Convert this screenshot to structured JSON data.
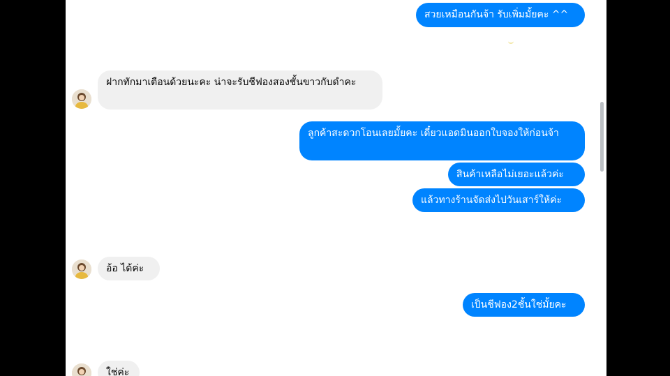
{
  "messages": [
    {
      "id": "m1",
      "side": "outgoing",
      "text": "สวยเหมือนกันจ้า รับเพิ่มมั้ยคะ ^^"
    },
    {
      "id": "m2",
      "side": "incoming",
      "text": "ฝากทักมาเตือนด้วยนะคะ  น่าจะรับชีฟองสองชั้นขาวกับดำคะ"
    },
    {
      "id": "m3",
      "side": "outgoing",
      "text": "ลูกค้าสะดวกโอนเลยมั้ยคะ เดี๋ยวแอดมินออกใบจองให้ก่อนจ้า"
    },
    {
      "id": "m4",
      "side": "outgoing",
      "text": "สินค้าเหลือไม่เยอะแล้วค่ะ"
    },
    {
      "id": "m5",
      "side": "outgoing",
      "text": "แล้วทางร้านจัดส่งไปวันเสาร์ให้ค่ะ"
    },
    {
      "id": "m6",
      "side": "incoming",
      "text": "อ้อ  ได้ค่ะ"
    },
    {
      "id": "m7",
      "side": "outgoing",
      "text": "เป็นชีฟอง2ชั้นใช่มั้ยคะ"
    },
    {
      "id": "m8",
      "side": "incoming",
      "text": "ใช่ค่ะ"
    }
  ],
  "colors": {
    "outgoing_bubble": "#0084ff",
    "incoming_bubble": "#f0f0f0",
    "background": "#ffffff"
  },
  "icons": {
    "avatar": "contact-avatar-photo"
  }
}
